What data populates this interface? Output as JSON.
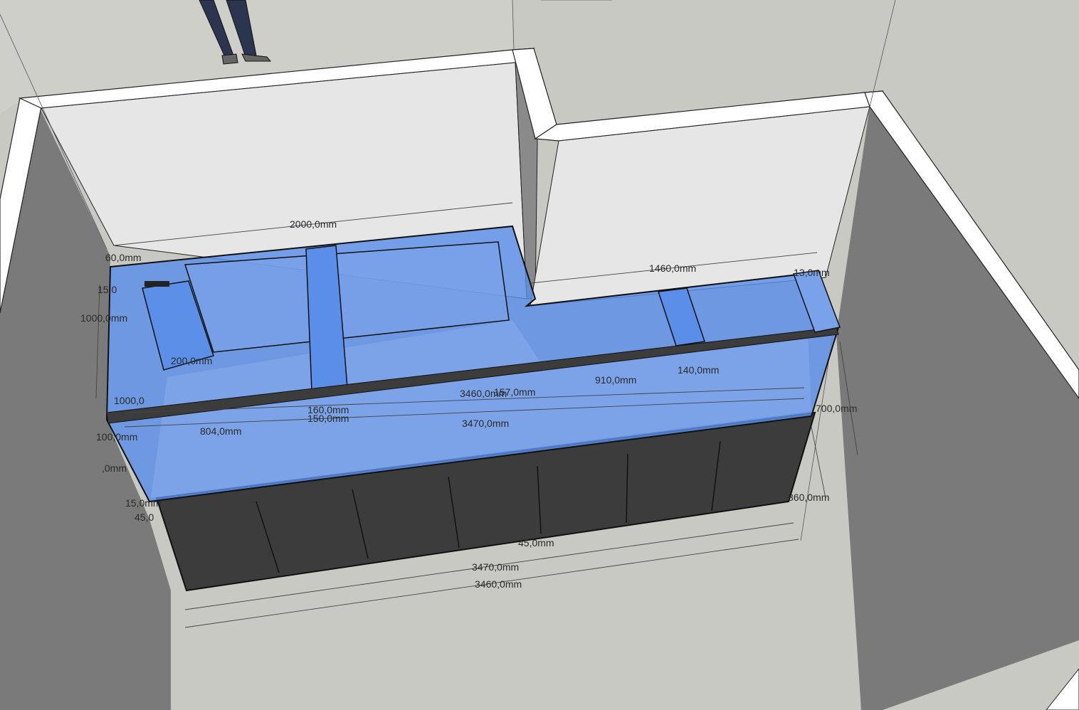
{
  "dimensions": {
    "main_tank_length": "2000,0mm",
    "side_tank_length": "1460,0mm",
    "glass_60": "60,0mm",
    "left_15": "15,0",
    "height_1000": "1000,0mm",
    "sump_divider": "200,0mm",
    "label_1000_small": "1000,0",
    "inner_3460": "3460,0mm",
    "inner_157": "157,0mm",
    "section_910": "910,0mm",
    "section_140": "140,0mm",
    "right_13": "13,0mm",
    "brace_160": "160,0mm",
    "brace_150": "150,0mm",
    "section_804": "804,0mm",
    "total_3470_top": "3470,0mm",
    "height_700": "700,0mm",
    "height_860": "860,0mm",
    "left_0": ",0mm",
    "left_100": "100,0mm",
    "left_15b": "15,0mm",
    "left_45": "45,0",
    "center_45": "45,0mm",
    "total_3470": "3470,0mm",
    "total_3460": "3460,0mm"
  },
  "colors": {
    "background": "#c9c9c4",
    "wall_top": "#ffffff",
    "wall_face": "#e6e6e6",
    "wall_side": "#7a7a7a",
    "glass_fill": "#5a8ee8",
    "glass_light": "#8fb2f0",
    "cabinet_front": "#3c3c3c",
    "outline": "#111111"
  }
}
